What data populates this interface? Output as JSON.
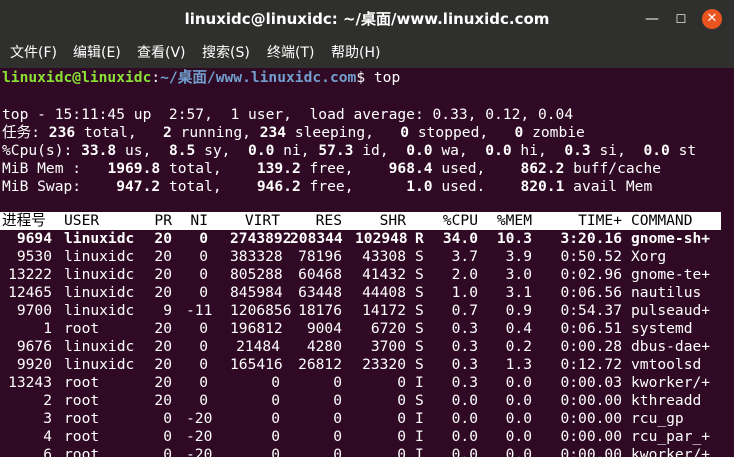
{
  "window": {
    "title": "linuxidc@linuxidc: ~/桌面/www.linuxidc.com",
    "min_glyph": "—",
    "max_glyph": "☐",
    "close_glyph": "✕",
    "icons": {
      "minimize": "minimize-icon",
      "maximize": "maximize-icon",
      "close": "close-icon"
    }
  },
  "menu": [
    {
      "label": "文件(F)"
    },
    {
      "label": "编辑(E)"
    },
    {
      "label": "查看(V)"
    },
    {
      "label": "搜索(S)"
    },
    {
      "label": "终端(T)"
    },
    {
      "label": "帮助(H)"
    }
  ],
  "prompt": {
    "user_host": "linuxidc@linuxidc",
    "sep": ":",
    "path": "~/桌面/www.linuxidc.com",
    "dollar": "$ ",
    "command": "top"
  },
  "summary": {
    "line1": "top - 15:11:45 up  2:57,  1 user,  load average: 0.33, 0.12, 0.04",
    "tasks": {
      "label": "任务:",
      "total": "236",
      "total_l": " total,   ",
      "running": "2",
      "running_l": " running, ",
      "sleeping": "234",
      "sleeping_l": " sleeping,   ",
      "stopped": "0",
      "stopped_l": " stopped,   ",
      "zombie": "0",
      "zombie_l": " zombie"
    },
    "cpu": {
      "label": "%Cpu(s): ",
      "us": "33.8",
      "us_l": " us,  ",
      "sy": "8.5",
      "sy_l": " sy,  ",
      "ni": "0.0",
      "ni_l": " ni, ",
      "id": "57.3",
      "id_l": " id,  ",
      "wa": "0.0",
      "wa_l": " wa,  ",
      "hi": "0.0",
      "hi_l": " hi,  ",
      "si": "0.3",
      "si_l": " si,  ",
      "st": "0.0",
      "st_l": " st"
    },
    "mem": {
      "label": "MiB Mem :   ",
      "total": "1969.8",
      "total_l": " total,    ",
      "free": "139.2",
      "free_l": " free,    ",
      "used": "968.4",
      "used_l": " used,    ",
      "buff": "862.2",
      "buff_l": " buff/cache"
    },
    "swap": {
      "label": "MiB Swap:    ",
      "total": "947.2",
      "total_l": " total,    ",
      "free": "946.2",
      "free_l": " free,      ",
      "used": "1.0",
      "used_l": " used.    ",
      "avail": "820.1",
      "avail_l": " avail Mem"
    }
  },
  "table": {
    "headers": [
      "进程号",
      "USER",
      "PR",
      "NI",
      "VIRT",
      "RES",
      "SHR",
      "",
      "%CPU",
      "%MEM",
      "TIME+",
      "COMMAND"
    ],
    "rows": [
      [
        "9694",
        "linuxidc",
        "20",
        "0",
        "2743892",
        "208344",
        "102948",
        "R",
        "34.0",
        "10.3",
        "3:20.16",
        "gnome-sh+"
      ],
      [
        "9530",
        "linuxidc",
        "20",
        "0",
        "383328",
        "78196",
        "43308",
        "S",
        "3.7",
        "3.9",
        "0:50.52",
        "Xorg"
      ],
      [
        "13222",
        "linuxidc",
        "20",
        "0",
        "805288",
        "60468",
        "41432",
        "S",
        "2.0",
        "3.0",
        "0:02.96",
        "gnome-te+"
      ],
      [
        "12465",
        "linuxidc",
        "20",
        "0",
        "845984",
        "63448",
        "44408",
        "S",
        "1.0",
        "3.1",
        "0:06.56",
        "nautilus"
      ],
      [
        "9700",
        "linuxidc",
        "9",
        "-11",
        "1206856",
        "18176",
        "14172",
        "S",
        "0.7",
        "0.9",
        "0:54.37",
        "pulseaud+"
      ],
      [
        "1",
        "root",
        "20",
        "0",
        "196812",
        "9004",
        "6720",
        "S",
        "0.3",
        "0.4",
        "0:06.51",
        "systemd"
      ],
      [
        "9676",
        "linuxidc",
        "20",
        "0",
        "21484",
        "4280",
        "3700",
        "S",
        "0.3",
        "0.2",
        "0:00.28",
        "dbus-dae+"
      ],
      [
        "9920",
        "linuxidc",
        "20",
        "0",
        "165416",
        "26812",
        "23320",
        "S",
        "0.3",
        "1.3",
        "0:12.72",
        "vmtoolsd"
      ],
      [
        "13243",
        "root",
        "20",
        "0",
        "0",
        "0",
        "0",
        "I",
        "0.3",
        "0.0",
        "0:00.03",
        "kworker/+"
      ],
      [
        "2",
        "root",
        "20",
        "0",
        "0",
        "0",
        "0",
        "S",
        "0.0",
        "0.0",
        "0:00.00",
        "kthreadd"
      ],
      [
        "3",
        "root",
        "0",
        "-20",
        "0",
        "0",
        "0",
        "I",
        "0.0",
        "0.0",
        "0:00.00",
        "rcu_gp"
      ],
      [
        "4",
        "root",
        "0",
        "-20",
        "0",
        "0",
        "0",
        "I",
        "0.0",
        "0.0",
        "0:00.00",
        "rcu_par_+"
      ],
      [
        "6",
        "root",
        "0",
        "-20",
        "0",
        "0",
        "0",
        "I",
        "0.0",
        "0.0",
        "0:00.00",
        "kworker/+"
      ]
    ]
  }
}
